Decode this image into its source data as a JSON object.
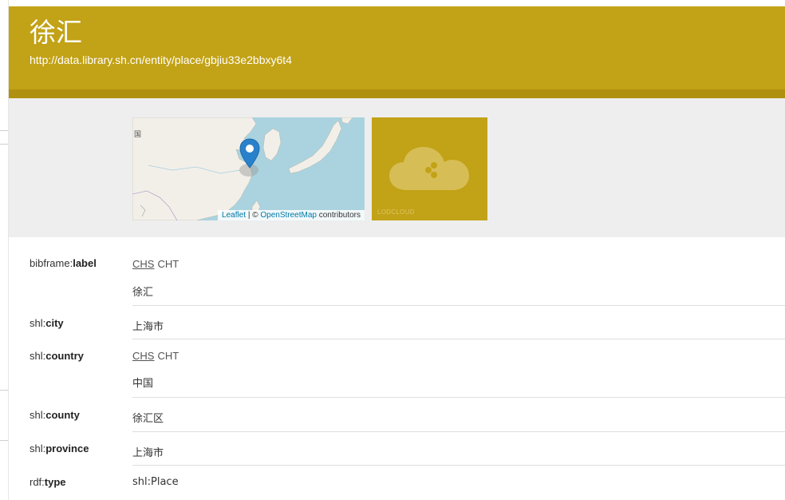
{
  "header": {
    "title": "徐汇",
    "uri": "http://data.library.sh.cn/entity/place/gbjiu33e2bbxy6t4"
  },
  "map": {
    "corner_label": "国",
    "attribution": {
      "leaflet": "Leaflet",
      "separator": " | © ",
      "osm": "OpenStreetMap",
      "suffix": " contributors"
    }
  },
  "lodcloud": {
    "label": "LODCLOUD"
  },
  "properties": [
    {
      "prefix": "bibframe:",
      "name": "label",
      "languages": [
        "CHS",
        "CHT"
      ],
      "active_language": "CHS",
      "value": "徐汇"
    },
    {
      "prefix": "shl:",
      "name": "city",
      "value": "上海市"
    },
    {
      "prefix": "shl:",
      "name": "country",
      "languages": [
        "CHS",
        "CHT"
      ],
      "active_language": "CHS",
      "value": "中国"
    },
    {
      "prefix": "shl:",
      "name": "county",
      "value": "徐汇区"
    },
    {
      "prefix": "shl:",
      "name": "province",
      "value": "上海市"
    },
    {
      "prefix": "rdf:",
      "name": "type",
      "value": "shl:Place"
    }
  ],
  "colors": {
    "header": "#c2a216",
    "header_bottom": "#af900f",
    "band": "#eeeeee",
    "sea": "#aad3df",
    "land": "#f2efe9",
    "marker": "#2a81cb"
  }
}
